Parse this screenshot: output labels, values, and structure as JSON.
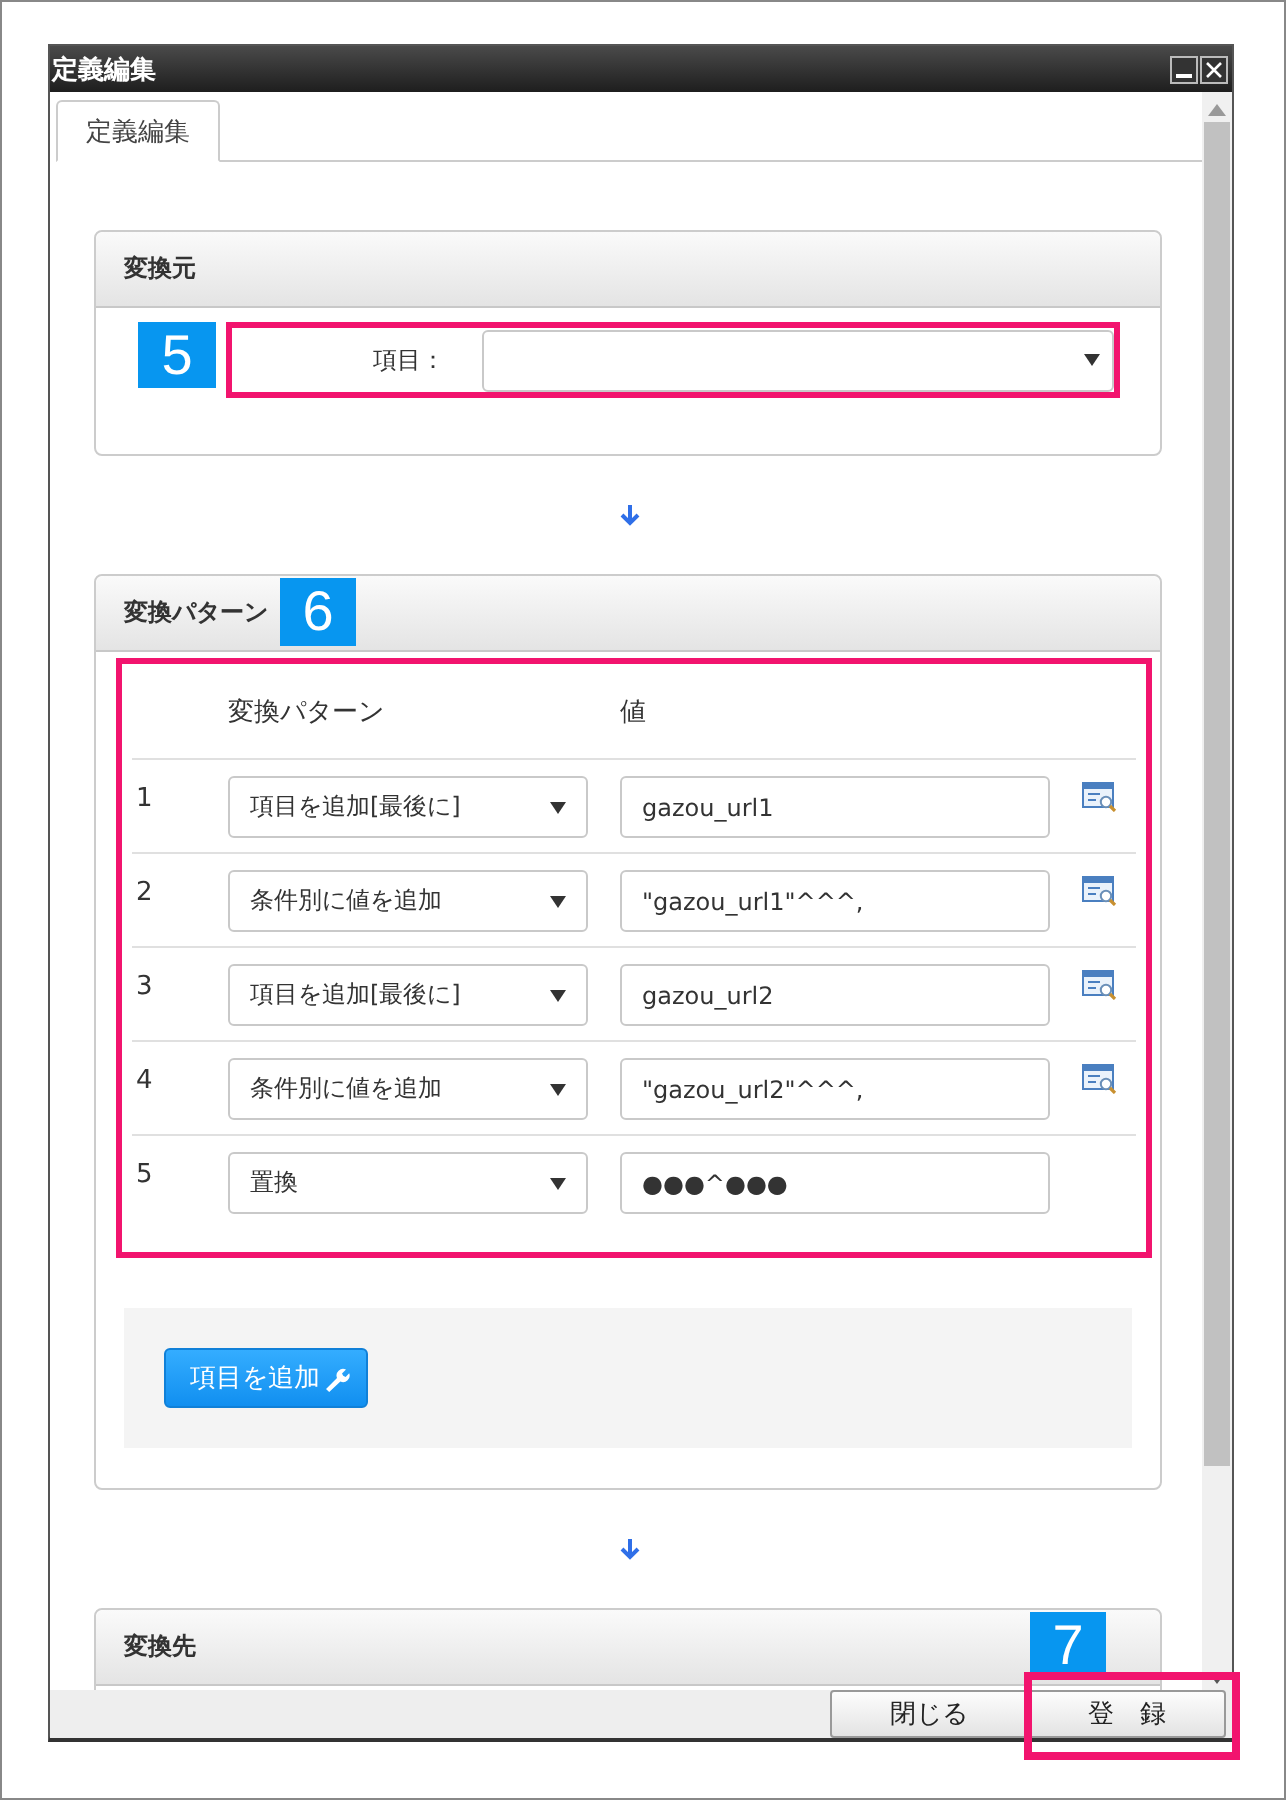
{
  "window": {
    "title": "定義編集"
  },
  "tabs": [
    {
      "label": "定義編集",
      "selected": true
    }
  ],
  "source": {
    "heading": "変換元",
    "callout": "5",
    "field_label": "項目："
  },
  "pattern": {
    "heading": "変換パターン",
    "callout": "6",
    "columns": [
      "変換パターン",
      "値"
    ],
    "rows": [
      {
        "number": "1",
        "pattern": "項目を追加[最後に]",
        "value": "gazou_url1",
        "lookup": true
      },
      {
        "number": "2",
        "pattern": "条件別に値を追加",
        "value": "\"gazou_url1\"^^^,",
        "lookup": true
      },
      {
        "number": "3",
        "pattern": "項目を追加[最後に]",
        "value": "gazou_url2",
        "lookup": true
      },
      {
        "number": "4",
        "pattern": "条件別に値を追加",
        "value": "\"gazou_url2\"^^^,",
        "lookup": true
      },
      {
        "number": "5",
        "pattern": "置換",
        "value": "●●●^●●●",
        "lookup": false
      }
    ],
    "add_button": "項目を追加"
  },
  "target": {
    "heading": "変換先",
    "callout": "7"
  },
  "buttons": [
    {
      "label": "閉じる",
      "highlighted": false
    },
    {
      "label": "登　録",
      "highlighted": true
    }
  ]
}
